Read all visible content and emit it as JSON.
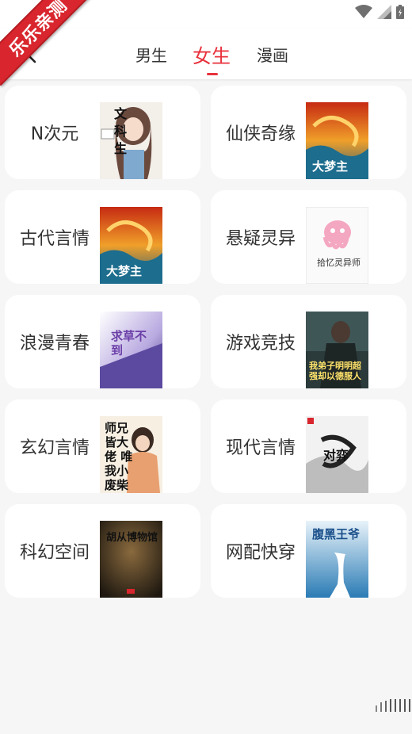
{
  "watermark": "乐乐亲测",
  "header": {
    "back_icon": "back-arrow-icon",
    "tabs": [
      {
        "label": "男生",
        "active": false
      },
      {
        "label": "女生",
        "active": true
      },
      {
        "label": "漫画",
        "active": false
      }
    ]
  },
  "colors": {
    "accent": "#e8323c",
    "text": "#333333",
    "background": "#f6f6f6"
  },
  "categories": [
    {
      "label": "N次元",
      "cover_title": "文科生"
    },
    {
      "label": "仙侠奇缘",
      "cover_title": "大梦主"
    },
    {
      "label": "古代言情",
      "cover_title": "大梦主"
    },
    {
      "label": "悬疑灵异",
      "cover_title": "拾忆灵异师"
    },
    {
      "label": "浪漫青春",
      "cover_title": "求草不到"
    },
    {
      "label": "游戏竞技",
      "cover_title": "我弟子明明超强却以德服人"
    },
    {
      "label": "玄幻言情",
      "cover_title": "师兄皆大佬 唯我小废柴"
    },
    {
      "label": "现代言情",
      "cover_title": "对弈"
    },
    {
      "label": "科幻空间",
      "cover_title": "胡从博物馆"
    },
    {
      "label": "网配快穿",
      "cover_title": "腹黑王爷"
    }
  ]
}
